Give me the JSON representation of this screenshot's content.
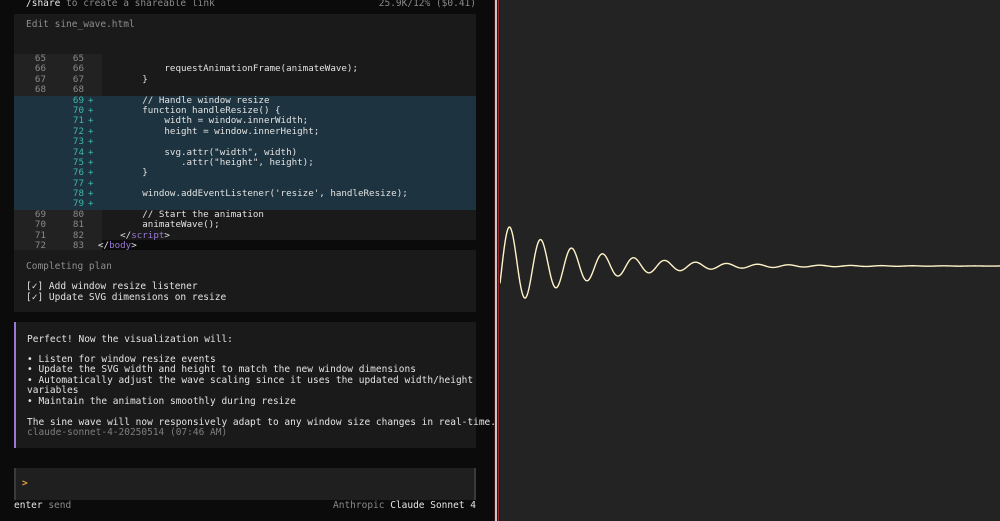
{
  "top_bar": {
    "command": "/share",
    "hint": " to create a shareable link",
    "usage": "25.9K/12% ($0.41)"
  },
  "edit_panel": {
    "title": "Edit sine_wave.html",
    "lines": [
      {
        "old": "65",
        "new": "65",
        "mark": "",
        "text": "",
        "added": false
      },
      {
        "old": "66",
        "new": "66",
        "mark": "",
        "text": "            requestAnimationFrame(animateWave);",
        "added": false
      },
      {
        "old": "67",
        "new": "67",
        "mark": "",
        "text": "        }",
        "added": false
      },
      {
        "old": "68",
        "new": "68",
        "mark": "",
        "text": "",
        "added": false
      },
      {
        "old": "",
        "new": "69",
        "mark": "+",
        "text": "        // Handle window resize",
        "added": true
      },
      {
        "old": "",
        "new": "70",
        "mark": "+",
        "text": "        function handleResize() {",
        "added": true
      },
      {
        "old": "",
        "new": "71",
        "mark": "+",
        "text": "            width = window.innerWidth;",
        "added": true
      },
      {
        "old": "",
        "new": "72",
        "mark": "+",
        "text": "            height = window.innerHeight;",
        "added": true
      },
      {
        "old": "",
        "new": "73",
        "mark": "+",
        "text": "",
        "added": true
      },
      {
        "old": "",
        "new": "74",
        "mark": "+",
        "text": "            svg.attr(\"width\", width)",
        "added": true
      },
      {
        "old": "",
        "new": "75",
        "mark": "+",
        "text": "               .attr(\"height\", height);",
        "added": true
      },
      {
        "old": "",
        "new": "76",
        "mark": "+",
        "text": "        }",
        "added": true
      },
      {
        "old": "",
        "new": "77",
        "mark": "+",
        "text": "",
        "added": true
      },
      {
        "old": "",
        "new": "78",
        "mark": "+",
        "text": "        window.addEventListener('resize', handleResize);",
        "added": true
      },
      {
        "old": "",
        "new": "79",
        "mark": "+",
        "text": "",
        "added": true
      },
      {
        "old": "69",
        "new": "80",
        "mark": "",
        "text": "        // Start the animation",
        "added": false
      },
      {
        "old": "70",
        "new": "81",
        "mark": "",
        "text": "        animateWave();",
        "added": false
      },
      {
        "old": "71",
        "new": "82",
        "mark": "",
        "text": "    </",
        "tag": "script",
        "tail": ">",
        "added": false
      },
      {
        "old": "72",
        "new": "83",
        "mark": "",
        "text": "</",
        "tag": "body",
        "tail": ">",
        "added": false
      }
    ]
  },
  "plan_panel": {
    "title": "Completing plan",
    "items": [
      "[✓] Add window resize listener",
      "[✓] Update SVG dimensions on resize"
    ]
  },
  "message": {
    "lines": [
      "Perfect! Now the visualization will:",
      "",
      "• Listen for window resize events",
      "• Update the SVG width and height to match the new window dimensions",
      "• Automatically adjust the wave scaling since it uses the updated width/height",
      "variables",
      "• Maintain the animation smoothly during resize",
      "",
      "The sine wave will now responsively adapt to any window size changes in real-time."
    ],
    "meta": "claude-sonnet-4-20250514 (07:46 AM)"
  },
  "input": {
    "prompt": ">"
  },
  "bottom_bar": {
    "key": "enter",
    "action": " send",
    "provider": "Anthropic ",
    "model": "Claude Sonnet 4"
  },
  "colors": {
    "accent_purple": "#9a78d6",
    "added_bg": "#1d3340",
    "added_num": "#3fb9a6",
    "wave": "#fff4c8",
    "viz_bg": "#232323"
  }
}
